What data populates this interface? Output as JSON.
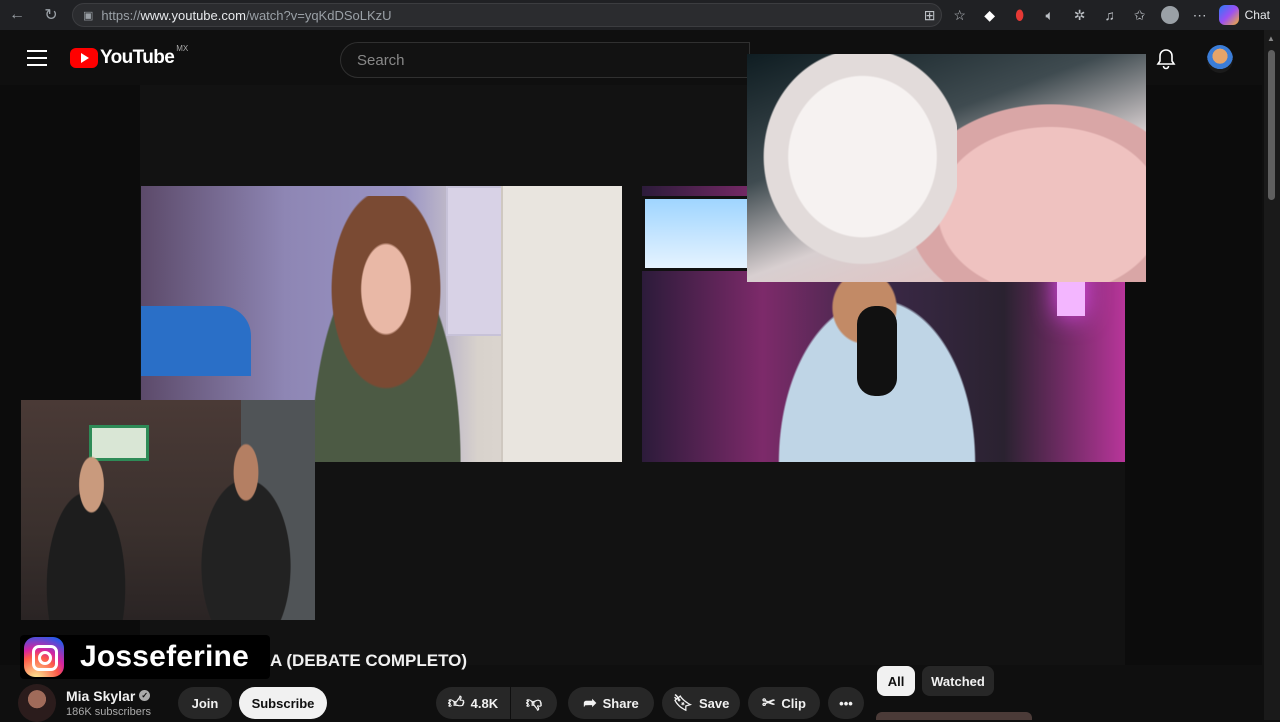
{
  "browser": {
    "url_prefix": "https://",
    "url_domain": "www.youtube.com",
    "url_path": "/watch?v=yqKdDSoLKzU",
    "chat_label": "Chat"
  },
  "youtube": {
    "logo_text": "YouTube",
    "country_code": "MX",
    "search_placeholder": "Search"
  },
  "overlay": {
    "instagram_handle": "Josseferine"
  },
  "video": {
    "title_visible": "A (DEBATE COMPLETO)",
    "channel_name": "Mia Skylar",
    "subscribers": "186K subscribers",
    "join_label": "Join",
    "subscribe_label": "Subscribe",
    "likes": "4.8K",
    "share_label": "Share",
    "save_label": "Save",
    "clip_label": "Clip",
    "more_label": "•••"
  },
  "filters": {
    "all_label": "All",
    "watched_label": "Watched"
  },
  "colors": {
    "youtube_red": "#ff0000",
    "background": "#0f0f0f",
    "pill_bg": "#272727"
  }
}
